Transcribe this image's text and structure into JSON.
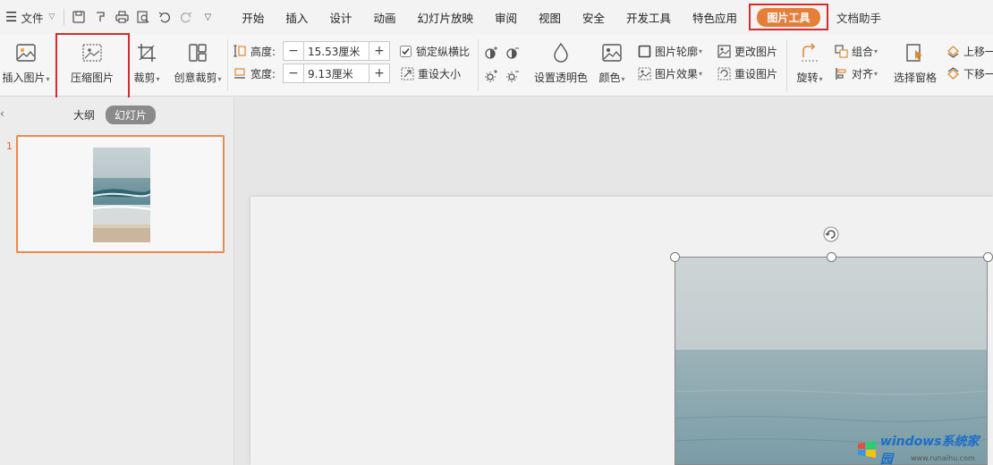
{
  "menubar": {
    "file_label": "文件",
    "tabs": [
      "开始",
      "插入",
      "设计",
      "动画",
      "幻灯片放映",
      "审阅",
      "视图",
      "安全",
      "开发工具",
      "特色应用"
    ],
    "active_tab": "图片工具",
    "extra_tab": "文档助手"
  },
  "ribbon": {
    "insert_picture": "插入图片",
    "compress_picture": "压缩图片",
    "crop": "裁剪",
    "creative_crop": "创意裁剪",
    "height_label": "高度:",
    "height_value": "15.53厘米",
    "width_label": "宽度:",
    "width_value": "9.13厘米",
    "lock_ratio": "锁定纵横比",
    "reset_size": "重设大小",
    "set_transparent": "设置透明色",
    "color": "颜色",
    "picture_outline": "图片轮廓",
    "picture_effects": "图片效果",
    "change_picture": "更改图片",
    "reset_picture": "重设图片",
    "rotate": "旋转",
    "group": "组合",
    "align": "对齐",
    "selection_pane": "选择窗格",
    "bring_forward": "上移一",
    "send_backward": "下移一"
  },
  "leftpanel": {
    "tab_outline": "大纲",
    "tab_slides": "幻灯片",
    "slide_number": "1"
  },
  "watermark": {
    "text": "windows系统家园",
    "sub": "www.runaihu.com"
  }
}
